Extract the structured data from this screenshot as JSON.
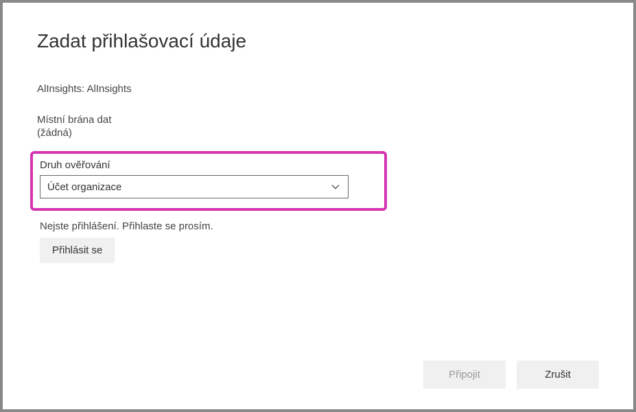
{
  "dialog": {
    "title": "Zadat přihlašovací údaje",
    "source_info": "AlInsights: AlInsights",
    "gateway": {
      "label": "Místní brána dat",
      "value": "(žádná)"
    },
    "auth": {
      "label": "Druh ověřování",
      "selected": "Účet organizace"
    },
    "status_text": "Nejste přihlášení. Přihlaste se prosím.",
    "signin_label": "Přihlásit se",
    "footer": {
      "connect_label": "Připojit",
      "cancel_label": "Zrušit"
    }
  }
}
